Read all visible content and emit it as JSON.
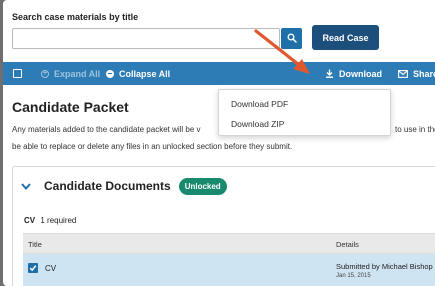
{
  "search": {
    "label": "Search case materials by title",
    "value": "",
    "placeholder": ""
  },
  "actions": {
    "read_case": "Read Case"
  },
  "toolbar": {
    "expand_all": "Expand All",
    "collapse_all": "Collapse All",
    "download": "Download",
    "share": "Share"
  },
  "download_menu": {
    "items": [
      "Download PDF",
      "Download ZIP"
    ]
  },
  "page": {
    "title": "Candidate Packet",
    "description_line1": "Any materials added to the candidate packet will be v",
    "description_tail": "to use in the",
    "description_line2": "be able to replace or delete any files in an unlocked section before they submit."
  },
  "section": {
    "title": "Candidate Documents",
    "badge": "Unlocked",
    "requirement_name": "CV",
    "requirement_count": "1 required"
  },
  "table": {
    "columns": [
      "Title",
      "Details"
    ],
    "rows": [
      {
        "title": "CV",
        "details": "Submitted by Michael Bishop",
        "date": "Jan 15, 2015",
        "checked": true
      }
    ]
  },
  "colors": {
    "toolbar": "#2e7cb6",
    "read_case": "#1d4f7c",
    "badge": "#1a8a6e",
    "arrow": "#e1582f",
    "selected_row": "#cfe4f3"
  }
}
